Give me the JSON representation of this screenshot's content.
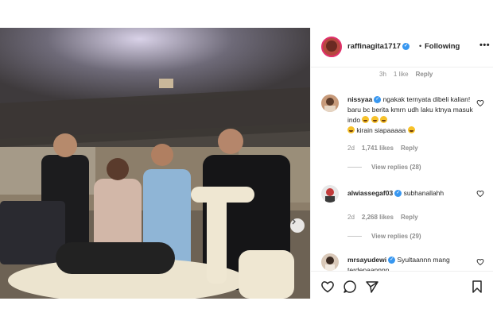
{
  "post": {
    "username": "raffinagita1717",
    "separator": "•",
    "follow_state": "Following",
    "more": "•••"
  },
  "top_meta": {
    "time": "3h",
    "likes": "1 like",
    "reply": "Reply"
  },
  "comments": [
    {
      "username": "nissyaa",
      "text": "ngakak ternyata dibeli kalian! baru bc berita kmrn udh laku ktnya masuk indo",
      "text2": "kirain siapaaaaa",
      "time": "2d",
      "likes": "1,741 likes",
      "reply": "Reply",
      "view_replies": "View replies (28)"
    },
    {
      "username": "alwiassegaf03",
      "text": "subhanallahh",
      "time": "2d",
      "likes": "2,268 likes",
      "reply": "Reply",
      "view_replies": "View replies (29)"
    },
    {
      "username": "mrsayudewi",
      "text": "Syultaannn mang terdepaannnn"
    }
  ],
  "icons": {
    "like": "heart-icon",
    "comment": "comment-icon",
    "share": "share-icon",
    "save": "bookmark-icon",
    "next": "chevron-right-icon",
    "verified": "verified-badge-icon"
  },
  "colors": {
    "accent": "#3897f0",
    "story_ring": "#e1306c",
    "muted": "#8e8e8e"
  }
}
